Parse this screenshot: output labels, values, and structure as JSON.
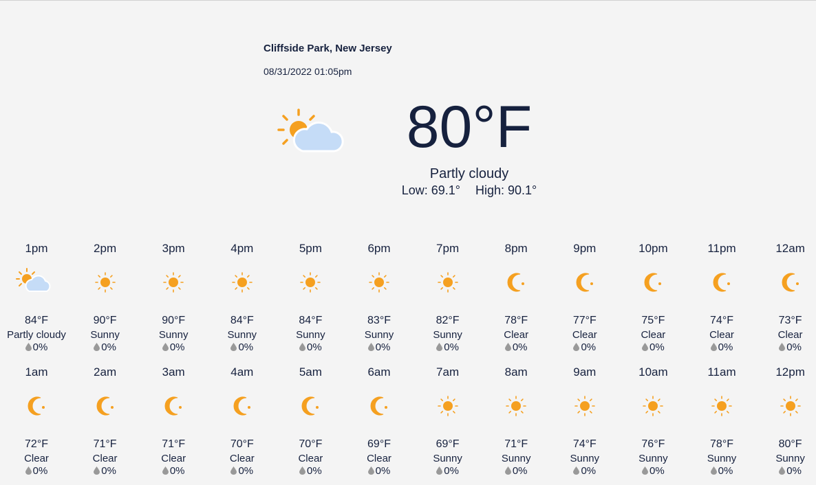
{
  "header": {
    "location": "Cliffside Park, New Jersey",
    "datetime": "08/31/2022 01:05pm"
  },
  "current": {
    "icon": "partly-cloudy-icon",
    "temp": "80°F",
    "condition": "Partly cloudy",
    "low": "Low: 69.1°",
    "high": "High: 90.1°"
  },
  "colors": {
    "sun": "#f5a020",
    "cloud": "#c5dcf7",
    "text": "#16213e",
    "drop": "#999999",
    "background": "#f4f4f4"
  },
  "hourly": [
    {
      "hour": "1pm",
      "temp": "84°F",
      "condition": "Partly cloudy",
      "rain": "0%",
      "icon": "partly-cloudy"
    },
    {
      "hour": "2pm",
      "temp": "90°F",
      "condition": "Sunny",
      "rain": "0%",
      "icon": "sun"
    },
    {
      "hour": "3pm",
      "temp": "90°F",
      "condition": "Sunny",
      "rain": "0%",
      "icon": "sun"
    },
    {
      "hour": "4pm",
      "temp": "84°F",
      "condition": "Sunny",
      "rain": "0%",
      "icon": "sun"
    },
    {
      "hour": "5pm",
      "temp": "84°F",
      "condition": "Sunny",
      "rain": "0%",
      "icon": "sun"
    },
    {
      "hour": "6pm",
      "temp": "83°F",
      "condition": "Sunny",
      "rain": "0%",
      "icon": "sun"
    },
    {
      "hour": "7pm",
      "temp": "82°F",
      "condition": "Sunny",
      "rain": "0%",
      "icon": "sun"
    },
    {
      "hour": "8pm",
      "temp": "78°F",
      "condition": "Clear",
      "rain": "0%",
      "icon": "moon"
    },
    {
      "hour": "9pm",
      "temp": "77°F",
      "condition": "Clear",
      "rain": "0%",
      "icon": "moon"
    },
    {
      "hour": "10pm",
      "temp": "75°F",
      "condition": "Clear",
      "rain": "0%",
      "icon": "moon"
    },
    {
      "hour": "11pm",
      "temp": "74°F",
      "condition": "Clear",
      "rain": "0%",
      "icon": "moon"
    },
    {
      "hour": "12am",
      "temp": "73°F",
      "condition": "Clear",
      "rain": "0%",
      "icon": "moon"
    },
    {
      "hour": "1am",
      "temp": "72°F",
      "condition": "Clear",
      "rain": "0%",
      "icon": "moon"
    },
    {
      "hour": "2am",
      "temp": "71°F",
      "condition": "Clear",
      "rain": "0%",
      "icon": "moon"
    },
    {
      "hour": "3am",
      "temp": "71°F",
      "condition": "Clear",
      "rain": "0%",
      "icon": "moon"
    },
    {
      "hour": "4am",
      "temp": "70°F",
      "condition": "Clear",
      "rain": "0%",
      "icon": "moon"
    },
    {
      "hour": "5am",
      "temp": "70°F",
      "condition": "Clear",
      "rain": "0%",
      "icon": "moon"
    },
    {
      "hour": "6am",
      "temp": "69°F",
      "condition": "Clear",
      "rain": "0%",
      "icon": "moon"
    },
    {
      "hour": "7am",
      "temp": "69°F",
      "condition": "Sunny",
      "rain": "0%",
      "icon": "sun"
    },
    {
      "hour": "8am",
      "temp": "71°F",
      "condition": "Sunny",
      "rain": "0%",
      "icon": "sun"
    },
    {
      "hour": "9am",
      "temp": "74°F",
      "condition": "Sunny",
      "rain": "0%",
      "icon": "sun"
    },
    {
      "hour": "10am",
      "temp": "76°F",
      "condition": "Sunny",
      "rain": "0%",
      "icon": "sun"
    },
    {
      "hour": "11am",
      "temp": "78°F",
      "condition": "Sunny",
      "rain": "0%",
      "icon": "sun"
    },
    {
      "hour": "12pm",
      "temp": "80°F",
      "condition": "Sunny",
      "rain": "0%",
      "icon": "sun"
    }
  ]
}
